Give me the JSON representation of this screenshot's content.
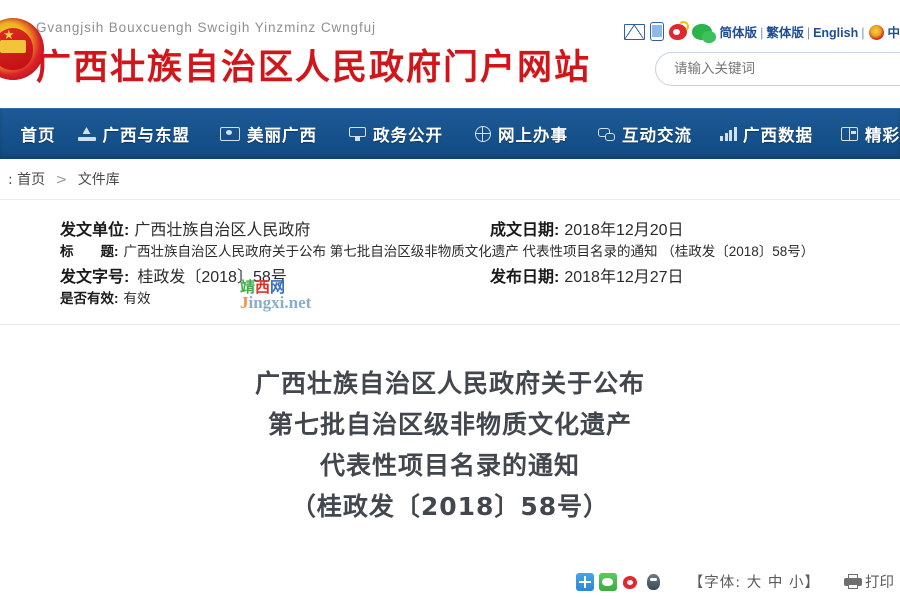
{
  "header": {
    "zhuang_title": "Gvangjsih Bouxcuengh Swcigih Yinzminz Cwngfuj",
    "cn_title": "广西壮族自治区人民政府门户网站",
    "emblem_icon": "national-emblem-icon",
    "top_icons": [
      "mail-icon",
      "mobile-icon",
      "weibo-icon",
      "wechat-icon"
    ],
    "lang_links": [
      "简体版",
      "繁体版",
      "English"
    ],
    "lang_separator": "|",
    "gov_portal_link": "中",
    "gov_portal_icon": "china-gov-emblem-icon"
  },
  "search": {
    "placeholder": "请输入关键词",
    "value": ""
  },
  "nav": {
    "items": [
      {
        "label": "首页",
        "icon": "home-icon"
      },
      {
        "label": "广西与东盟",
        "icon": "pavilion-icon"
      },
      {
        "label": "美丽广西",
        "icon": "eye-icon"
      },
      {
        "label": "政务公开",
        "icon": "monitor-icon"
      },
      {
        "label": "网上办事",
        "icon": "globe-icon"
      },
      {
        "label": "互动交流",
        "icon": "chat-bubbles-icon"
      },
      {
        "label": "广西数据",
        "icon": "bar-chart-icon"
      },
      {
        "label": "精彩",
        "icon": "window-panes-icon"
      }
    ]
  },
  "breadcrumb": {
    "prefix": "",
    "items": [
      "首页",
      "文件库"
    ],
    "separator": ">"
  },
  "meta": {
    "rows": [
      {
        "label": "发文单位:",
        "value": "广西壮族自治区人民政府"
      },
      {
        "label": "成文日期:",
        "value": "2018年12月20日"
      },
      {
        "label": "标　　题:",
        "value": "广西壮族自治区人民政府关于公布 第七批自治区级非物质文化遗产 代表性项目名录的通知 （桂政发〔2018〕58号）"
      },
      {
        "label": "发文字号:",
        "value": "桂政发〔2018〕58号"
      },
      {
        "label": "发布日期:",
        "value": "2018年12月27日"
      },
      {
        "label": "是否有效:",
        "value": "有效"
      }
    ],
    "publisher_label": "发文单位:",
    "publisher_value": "广西壮族自治区人民政府",
    "written_date_label": "成文日期:",
    "written_date_value": "2018年12月20日",
    "title_label": "标　　题:",
    "title_value": "广西壮族自治区人民政府关于公布 第七批自治区级非物质文化遗产 代表性项目名录的通知 （桂政发〔2018〕58号）",
    "docnum_label": "发文字号:",
    "docnum_value": "桂政发〔2018〕58号",
    "pub_date_label": "发布日期:",
    "pub_date_value": "2018年12月27日",
    "valid_label": "是否有效:",
    "valid_value": "有效"
  },
  "watermark": {
    "cn_chars": [
      "靖",
      "西",
      "网"
    ],
    "domain_prefix": "J",
    "domain_rest": "ingxi.net"
  },
  "document": {
    "title_lines": [
      "广西壮族自治区人民政府关于公布",
      "第七批自治区级非物质文化遗产",
      "代表性项目名录的通知",
      "（桂政发〔2018〕58号）"
    ]
  },
  "footer": {
    "share_icons": [
      "baidu-share-icon",
      "wechat-share-icon",
      "weibo-share-icon",
      "qq-share-icon"
    ],
    "font_label": "【字体:",
    "font_sizes": [
      "大",
      "中",
      "小"
    ],
    "font_label_end": "】",
    "print_label": "打印",
    "print_icon": "printer-icon"
  },
  "colors": {
    "brand_red": "#d0161a",
    "nav_blue": "#18538e",
    "link_blue": "#1f4e96",
    "text_dark": "#2b2b2b"
  }
}
